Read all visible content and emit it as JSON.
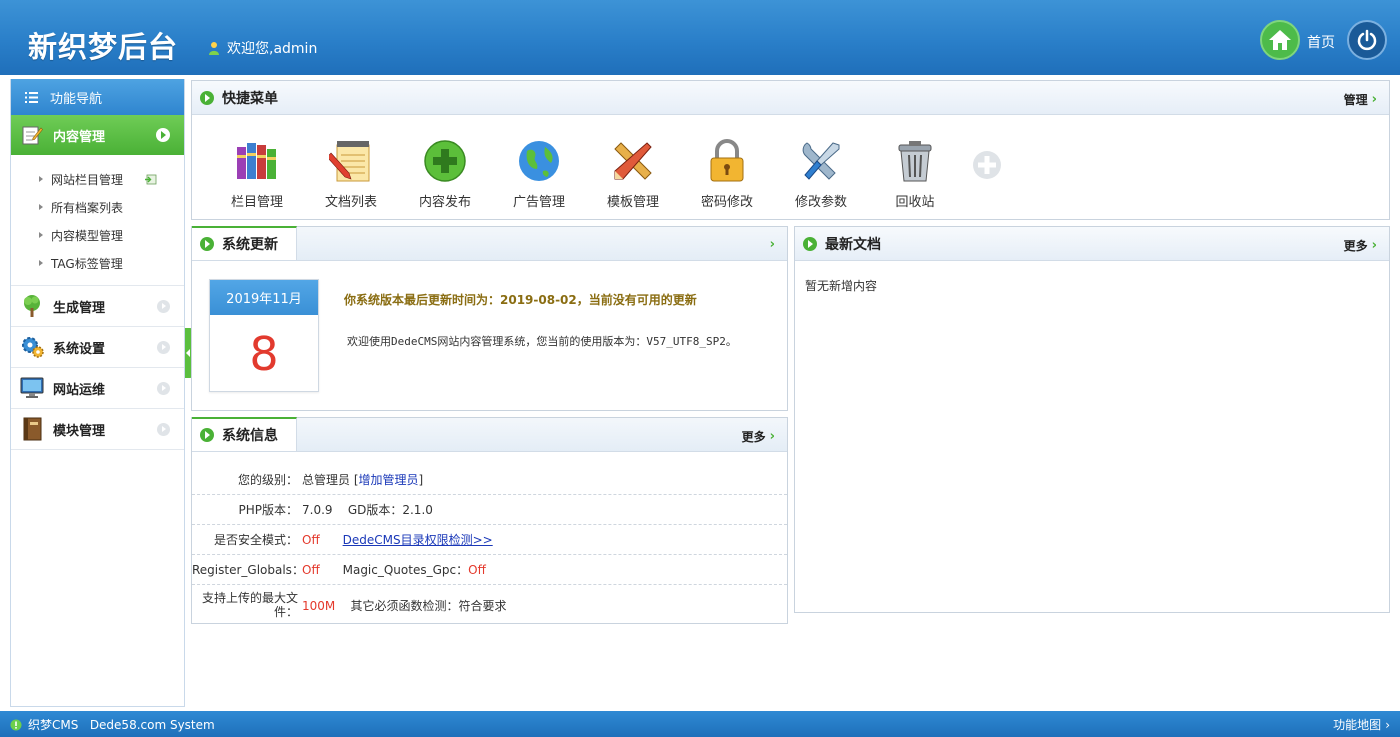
{
  "header": {
    "brand": "新织梦后台",
    "welcome": "欢迎您,admin",
    "home_label": "首页",
    "brand_color": "#2a7fc9"
  },
  "sidebar": {
    "nav_title": "功能导航",
    "active_menu": "内容管理",
    "submenu": [
      "网站栏目管理",
      "所有档案列表",
      "内容模型管理",
      "TAG标签管理"
    ],
    "menus": [
      "生成管理",
      "系统设置",
      "网站运维",
      "模块管理"
    ]
  },
  "quick": {
    "title": "快捷菜单",
    "manage": "管理",
    "items": [
      "栏目管理",
      "文档列表",
      "内容发布",
      "广告管理",
      "模板管理",
      "密码修改",
      "修改参数",
      "回收站"
    ]
  },
  "update": {
    "title": "系统更新",
    "cal_month": "2019年11月",
    "cal_day": "8",
    "msg": "你系统版本最后更新时间为：2019-08-02，当前没有可用的更新",
    "msg2": "欢迎使用DedeCMS网站内容管理系统，您当前的使用版本为：V57_UTF8_SP2。"
  },
  "latest": {
    "title": "最新文档",
    "more": "更多",
    "empty": "暂无新增内容"
  },
  "sysinfo": {
    "title": "系统信息",
    "more": "更多",
    "level_key": "您的级别：",
    "level_val": "总管理员",
    "add_admin": "增加管理员",
    "php_key": "PHP版本：",
    "php_val": "7.0.9",
    "gd_key": "GD版本：",
    "gd_val": "2.1.0",
    "safe_key": "是否安全模式：",
    "safe_val": "Off",
    "perm_link": "DedeCMS目录权限检测>>",
    "reg_key": "Register_Globals：",
    "reg_val": "Off",
    "magic_key": "Magic_Quotes_Gpc：",
    "magic_val": "Off",
    "upload_key": "支持上传的最大文件：",
    "upload_val": "100M",
    "func_key": "其它必须函数检测：",
    "func_val": "符合要求"
  },
  "footer": {
    "left": "织梦CMS",
    "system": "Dede58.com System",
    "right": "功能地图"
  }
}
